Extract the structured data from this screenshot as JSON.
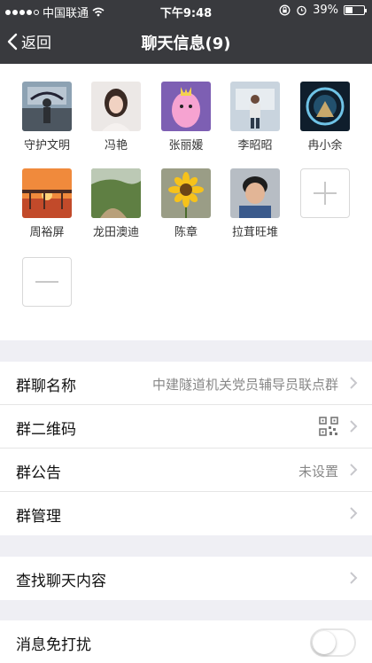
{
  "status_bar": {
    "carrier": "中国联通",
    "time": "下午9:48",
    "battery": "39%",
    "battery_level": 0.39
  },
  "nav": {
    "back_label": "返回",
    "title": "聊天信息(9)"
  },
  "members": [
    {
      "name": "守护文明",
      "avatar": "rainy-street-photo"
    },
    {
      "name": "冯艳",
      "avatar": "woman-portrait-photo"
    },
    {
      "name": "张丽媛",
      "avatar": "cartoon-princess-image"
    },
    {
      "name": "李昭昭",
      "avatar": "man-standing-photo"
    },
    {
      "name": "冉小余",
      "avatar": "glowing-portal-image"
    },
    {
      "name": "周裕屏",
      "avatar": "sunset-pier-photo"
    },
    {
      "name": "龙田澳迪",
      "avatar": "green-hills-photo"
    },
    {
      "name": "陈章",
      "avatar": "sunflower-photo"
    },
    {
      "name": "拉茸旺堆",
      "avatar": "boy-portrait-photo"
    }
  ],
  "settings": {
    "group_name_label": "群聊名称",
    "group_name_value": "中建隧道机关党员辅导员联点群",
    "qr_label": "群二维码",
    "notice_label": "群公告",
    "notice_value": "未设置",
    "manage_label": "群管理",
    "search_label": "查找聊天内容",
    "mute_label": "消息免打扰",
    "mute_on": false
  },
  "colors": {
    "nav_bg": "#393a3e",
    "page_bg": "#efeff4"
  }
}
